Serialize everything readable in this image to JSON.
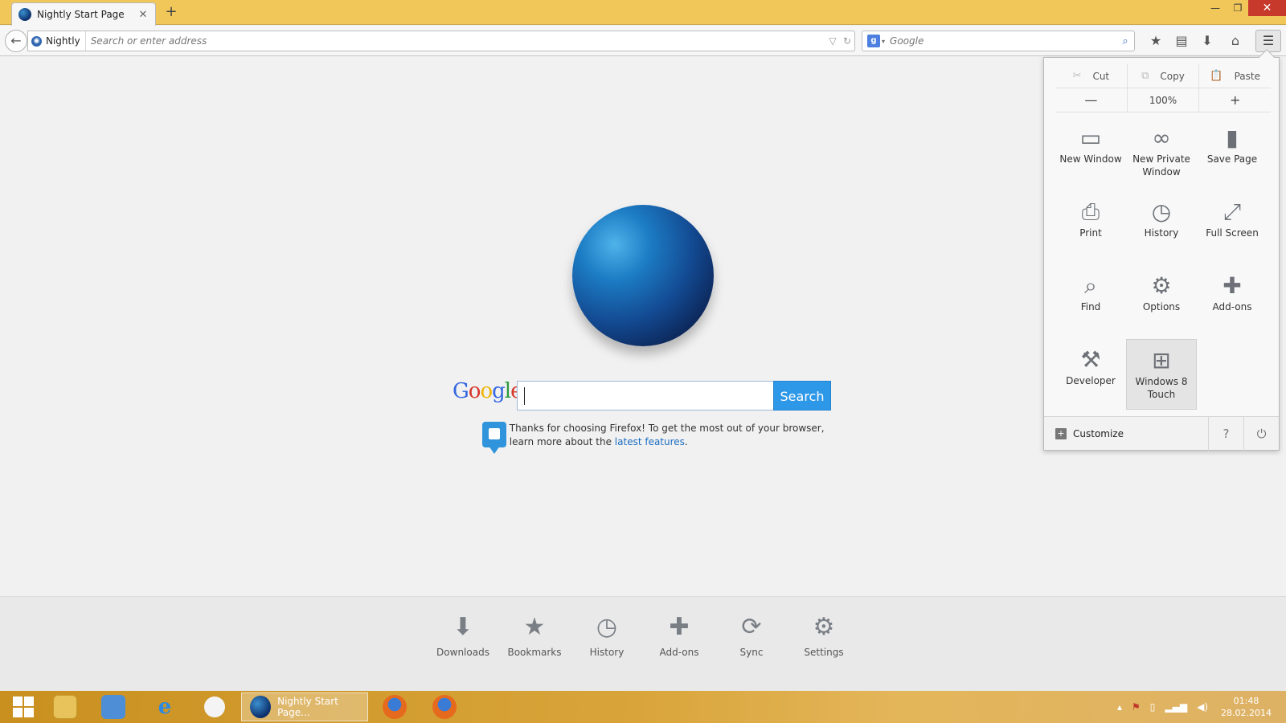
{
  "tab": {
    "title": "Nightly Start Page",
    "close": "✕"
  },
  "newtab": "+",
  "window": {
    "minimize": "—",
    "restore": "❐",
    "close": "✕"
  },
  "navbar": {
    "back": "←",
    "identity_label": "Nightly",
    "url_placeholder": "Search or enter address",
    "dropmarker": "▽",
    "reload": "↻",
    "search_engine": "g",
    "search_engine_drop": "▾",
    "search_placeholder": "Google",
    "search_go": "⌕",
    "bookmark_star": "★",
    "bookmarks_menu": "▤",
    "downloads": "⬇",
    "home": "⌂",
    "menu": "☰"
  },
  "content": {
    "google_logo": [
      "G",
      "o",
      "o",
      "g",
      "l",
      "e"
    ],
    "search_button": "Search",
    "snippet_text": "Thanks for choosing Firefox! To get the most out of your browser, learn more about the ",
    "snippet_link": "latest features",
    "snippet_end": "."
  },
  "launcher": [
    {
      "label": "Downloads",
      "icon": "⬇"
    },
    {
      "label": "Bookmarks",
      "icon": "★"
    },
    {
      "label": "History",
      "icon": "◷"
    },
    {
      "label": "Add-ons",
      "icon": "✚"
    },
    {
      "label": "Sync",
      "icon": "⟳"
    },
    {
      "label": "Settings",
      "icon": "⚙"
    }
  ],
  "panel": {
    "edit": [
      {
        "label": "Cut",
        "icon": "✂"
      },
      {
        "label": "Copy",
        "icon": "⧉"
      },
      {
        "label": "Paste",
        "icon": "📋"
      }
    ],
    "zoom": {
      "out": "—",
      "level": "100%",
      "in": "+"
    },
    "items": [
      {
        "label": "New Window",
        "icon": "▭"
      },
      {
        "label": "New Private Window",
        "icon": "∞"
      },
      {
        "label": "Save Page",
        "icon": "▮"
      },
      {
        "label": "Print",
        "icon": "⎙"
      },
      {
        "label": "History",
        "icon": "◷"
      },
      {
        "label": "Full Screen",
        "icon": "⤢"
      },
      {
        "label": "Find",
        "icon": "⌕"
      },
      {
        "label": "Options",
        "icon": "⚙"
      },
      {
        "label": "Add-ons",
        "icon": "✚"
      },
      {
        "label": "Developer",
        "icon": "⚒"
      },
      {
        "label": "Windows 8 Touch",
        "icon": "⊞"
      }
    ],
    "customize": "Customize",
    "help": "?",
    "quit": "⏻"
  },
  "taskbar": {
    "active_label": "Nightly Start Page...",
    "clock_time": "01:48",
    "clock_date": "28.02.2014",
    "tray_up": "▴",
    "tray_flag": "⚑",
    "tray_battery": "▯",
    "tray_signal": "▂▄▆",
    "tray_volume": "◀)"
  }
}
